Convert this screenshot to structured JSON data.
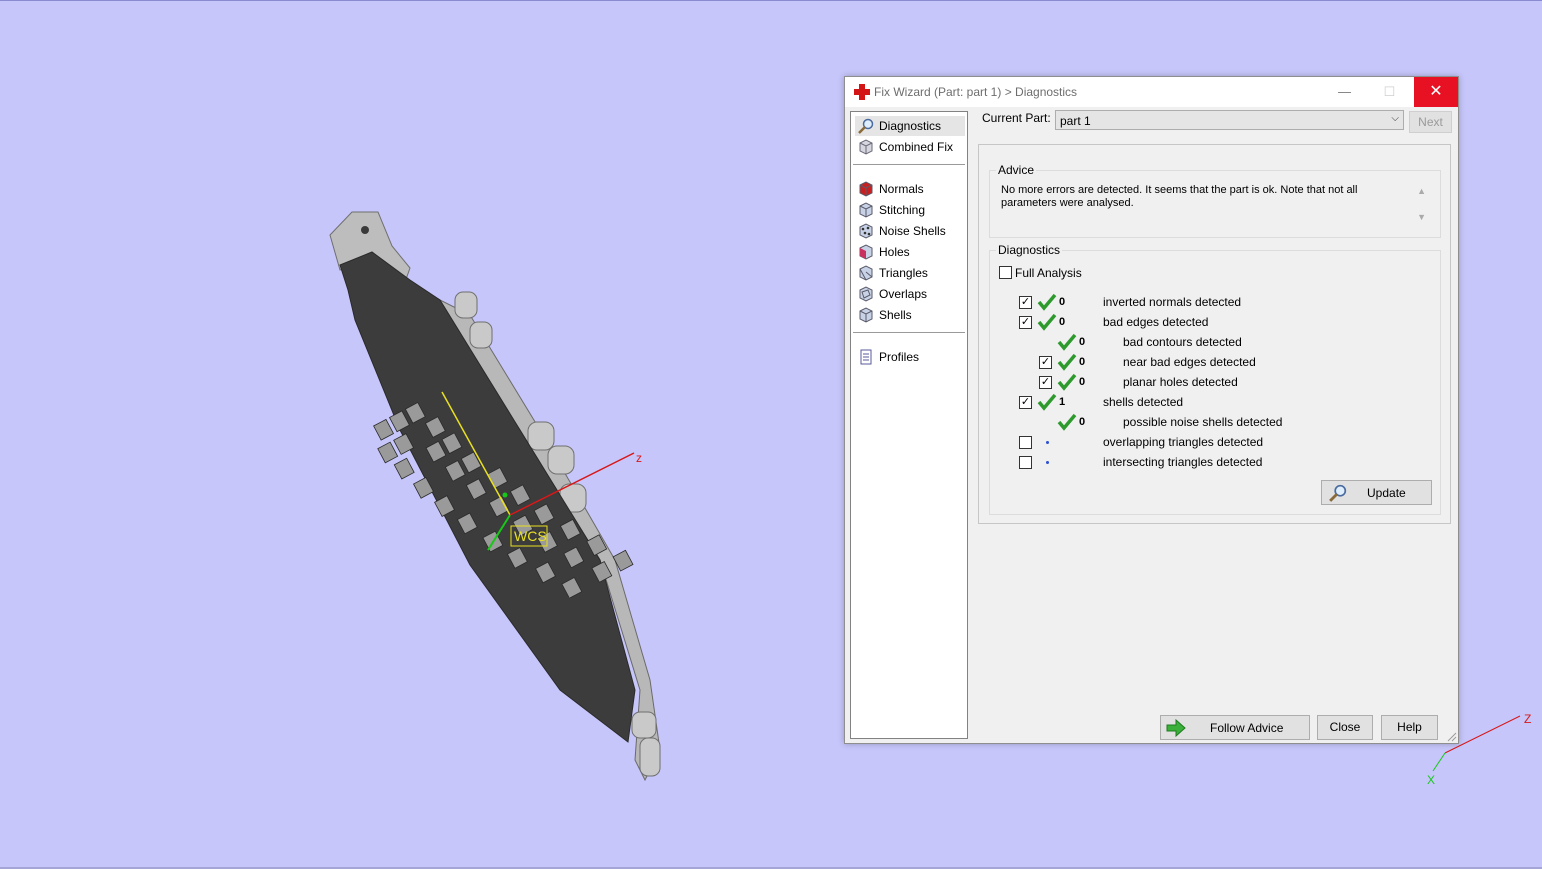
{
  "viewport": {
    "wcs_label": "WCS",
    "axis_z_label": "z",
    "triad": {
      "z_label": "Z",
      "x_label": "X"
    },
    "colors": {
      "background": "#c6c6fb",
      "part": "#3a3a3a",
      "axis_z": "#d81818",
      "axis_x": "#18c818",
      "axis_y": "#e8e020"
    }
  },
  "dialog": {
    "title": "Fix Wizard (Part: part 1) > Diagnostics",
    "title_icon": "red-cross-icon",
    "controls": {
      "minimize": "—",
      "maximize": "☐",
      "close": "✕"
    },
    "sidebar": {
      "items": [
        {
          "label": "Diagnostics",
          "icon": "magnifier-icon",
          "active": true
        },
        {
          "label": "Combined Fix",
          "icon": "cube-icon"
        },
        {
          "label": "Normals",
          "icon": "normals-icon"
        },
        {
          "label": "Stitching",
          "icon": "stitching-icon"
        },
        {
          "label": "Noise Shells",
          "icon": "noise-shells-icon"
        },
        {
          "label": "Holes",
          "icon": "holes-icon"
        },
        {
          "label": "Triangles",
          "icon": "triangles-icon"
        },
        {
          "label": "Overlaps",
          "icon": "overlaps-icon"
        },
        {
          "label": "Shells",
          "icon": "shells-icon"
        },
        {
          "label": "Profiles",
          "icon": "profiles-icon"
        }
      ]
    },
    "current_part": {
      "label": "Current Part:",
      "value": "part 1"
    },
    "next_label": "Next",
    "advice": {
      "title": "Advice",
      "text": "No more errors are detected. It seems that the part is ok. Note that not all parameters were analysed."
    },
    "diagnostics": {
      "title": "Diagnostics",
      "full_analysis": {
        "label": "Full Analysis",
        "checked": false
      },
      "rows": [
        {
          "checkbox": true,
          "checked": true,
          "status": "ok",
          "count": "0",
          "label": "inverted normals detected",
          "indent": 0
        },
        {
          "checkbox": true,
          "checked": true,
          "status": "ok",
          "count": "0",
          "label": "bad edges detected",
          "indent": 0
        },
        {
          "checkbox": false,
          "checked": false,
          "status": "ok",
          "count": "0",
          "label": "bad contours detected",
          "indent": 1
        },
        {
          "checkbox": true,
          "checked": true,
          "status": "ok",
          "count": "0",
          "label": "near bad edges detected",
          "indent": 1
        },
        {
          "checkbox": true,
          "checked": true,
          "status": "ok",
          "count": "0",
          "label": "planar holes detected",
          "indent": 1
        },
        {
          "checkbox": true,
          "checked": true,
          "status": "ok",
          "count": "1",
          "label": "shells detected",
          "indent": 0
        },
        {
          "checkbox": false,
          "checked": false,
          "status": "ok",
          "count": "0",
          "label": "possible noise shells detected",
          "indent": 1
        },
        {
          "checkbox": true,
          "checked": false,
          "status": "none",
          "count": "",
          "label": "overlapping triangles detected",
          "indent": 0
        },
        {
          "checkbox": true,
          "checked": false,
          "status": "none",
          "count": "",
          "label": "intersecting triangles detected",
          "indent": 0
        }
      ],
      "update_label": "Update"
    },
    "buttons": {
      "follow_advice": "Follow Advice",
      "close": "Close",
      "help": "Help"
    }
  }
}
